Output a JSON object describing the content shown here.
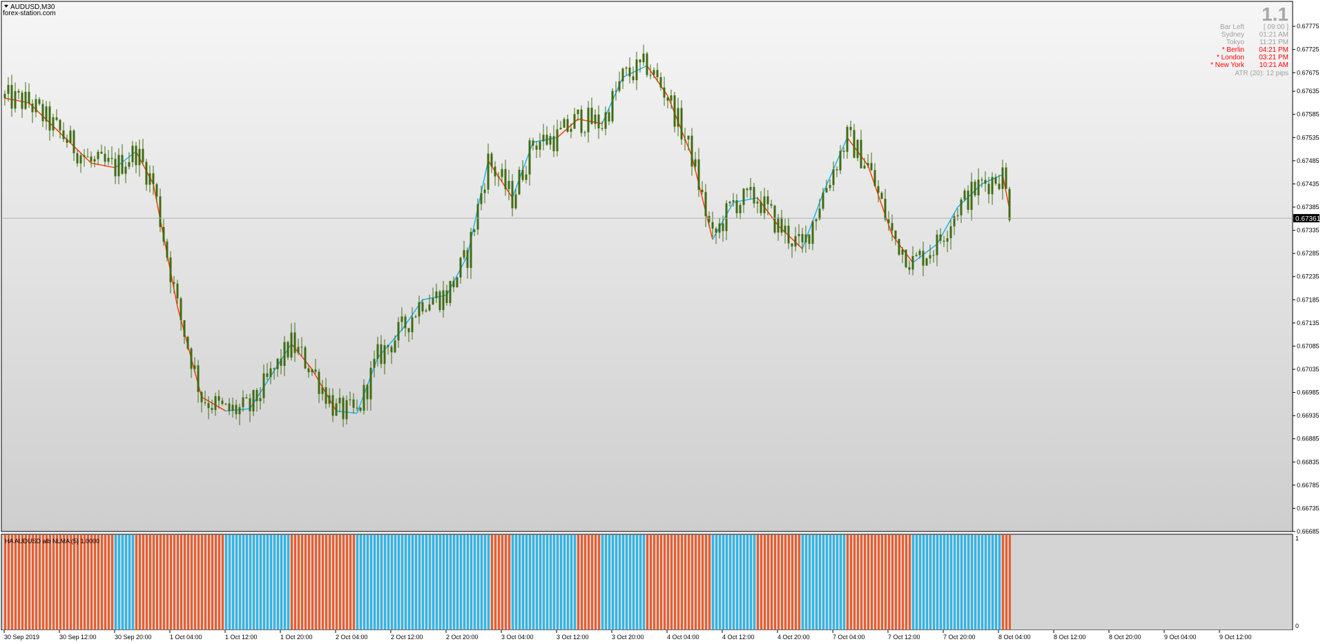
{
  "header": {
    "symbol_label": "AUDUSD,M30",
    "watermark": "forex-station.com"
  },
  "info_panel": {
    "big_value": "1.1",
    "rows": [
      {
        "label": "Bar Left",
        "value": "[ 09:00 ]",
        "color": "#a0a0a0"
      },
      {
        "label": "Sydney",
        "value": "01:21 AM",
        "color": "#a0a0a0"
      },
      {
        "label": "Tokyo",
        "value": "11:21 PM",
        "color": "#a0a0a0"
      },
      {
        "label": "* Berlin",
        "value": "04:21 PM",
        "color": "#ff0000"
      },
      {
        "label": "* London",
        "value": "03:21 PM",
        "color": "#ff0000"
      },
      {
        "label": "* New York",
        "value": "10:21 AM",
        "color": "#ff0000"
      }
    ],
    "atr_text": "ATR (20): 12 pips"
  },
  "colors": {
    "candle": "#3f6b12",
    "up_line": "#1ab2f0",
    "down_line": "#ff3c00",
    "hist_up": "#27b8ee",
    "hist_down": "#f05a28",
    "price_marker_bg": "#000000",
    "price_marker_fg": "#ffffff"
  },
  "chart_data": [
    {
      "type": "candlestick",
      "symbol": "AUDUSD",
      "timeframe": "M30",
      "ylim": [
        0.66685,
        0.67805
      ],
      "y_ticks": [
        "0.67775",
        "0.67725",
        "0.67675",
        "0.67635",
        "0.67585",
        "0.67535",
        "0.67485",
        "0.67435",
        "0.67385",
        "0.67335",
        "0.67285",
        "0.67235",
        "0.67185",
        "0.67135",
        "0.67085",
        "0.67035",
        "0.66985",
        "0.66935",
        "0.66885",
        "0.66835",
        "0.66785",
        "0.66735",
        "0.66685"
      ],
      "current_price": "0.67361",
      "x_ticks": [
        "30 Sep 2019",
        "30 Sep 12:00",
        "30 Sep 20:00",
        "1 Oct 04:00",
        "1 Oct 12:00",
        "1 Oct 20:00",
        "2 Oct 04:00",
        "2 Oct 12:00",
        "2 Oct 20:00",
        "3 Oct 04:00",
        "3 Oct 12:00",
        "3 Oct 20:00",
        "4 Oct 04:00",
        "4 Oct 12:00",
        "4 Oct 20:00",
        "7 Oct 04:00",
        "7 Oct 12:00",
        "7 Oct 20:00",
        "8 Oct 04:00",
        "8 Oct 12:00",
        "8 Oct 20:00",
        "9 Oct 04:00",
        "9 Oct 12:00"
      ],
      "trend_line": [
        {
          "bar": 0,
          "price": 0.6762,
          "dir": "down"
        },
        {
          "bar": 7,
          "price": 0.6761,
          "dir": "down"
        },
        {
          "bar": 25,
          "price": 0.6748,
          "dir": "down"
        },
        {
          "bar": 32,
          "price": 0.6747,
          "dir": "up"
        },
        {
          "bar": 38,
          "price": 0.67505,
          "dir": "down"
        },
        {
          "bar": 43,
          "price": 0.67435,
          "dir": "down"
        },
        {
          "bar": 50,
          "price": 0.6717,
          "dir": "down"
        },
        {
          "bar": 57,
          "price": 0.66975,
          "dir": "down"
        },
        {
          "bar": 64,
          "price": 0.66945,
          "dir": "up"
        },
        {
          "bar": 71,
          "price": 0.6695,
          "dir": "up"
        },
        {
          "bar": 83,
          "price": 0.6709,
          "dir": "down"
        },
        {
          "bar": 89,
          "price": 0.67035,
          "dir": "down"
        },
        {
          "bar": 96,
          "price": 0.66945,
          "dir": "up"
        },
        {
          "bar": 102,
          "price": 0.6694,
          "dir": "up"
        },
        {
          "bar": 108,
          "price": 0.6706,
          "dir": "up"
        },
        {
          "bar": 115,
          "price": 0.6712,
          "dir": "up"
        },
        {
          "bar": 121,
          "price": 0.67185,
          "dir": "up"
        },
        {
          "bar": 128,
          "price": 0.67195,
          "dir": "up"
        },
        {
          "bar": 134,
          "price": 0.6728,
          "dir": "up"
        },
        {
          "bar": 140,
          "price": 0.67485,
          "dir": "down"
        },
        {
          "bar": 147,
          "price": 0.67405,
          "dir": "up"
        },
        {
          "bar": 153,
          "price": 0.67525,
          "dir": "up"
        },
        {
          "bar": 160,
          "price": 0.67535,
          "dir": "down"
        },
        {
          "bar": 166,
          "price": 0.67575,
          "dir": "down"
        },
        {
          "bar": 173,
          "price": 0.67565,
          "dir": "up"
        },
        {
          "bar": 179,
          "price": 0.67665,
          "dir": "up"
        },
        {
          "bar": 186,
          "price": 0.6769,
          "dir": "down"
        },
        {
          "bar": 192,
          "price": 0.67625,
          "dir": "down"
        },
        {
          "bar": 199,
          "price": 0.67495,
          "dir": "down"
        },
        {
          "bar": 205,
          "price": 0.67315,
          "dir": "up"
        },
        {
          "bar": 211,
          "price": 0.67395,
          "dir": "up"
        },
        {
          "bar": 218,
          "price": 0.67405,
          "dir": "down"
        },
        {
          "bar": 224,
          "price": 0.67345,
          "dir": "down"
        },
        {
          "bar": 231,
          "price": 0.67295,
          "dir": "up"
        },
        {
          "bar": 237,
          "price": 0.67415,
          "dir": "up"
        },
        {
          "bar": 244,
          "price": 0.67535,
          "dir": "down"
        },
        {
          "bar": 250,
          "price": 0.67475,
          "dir": "down"
        },
        {
          "bar": 257,
          "price": 0.67325,
          "dir": "down"
        },
        {
          "bar": 263,
          "price": 0.67265,
          "dir": "up"
        },
        {
          "bar": 270,
          "price": 0.67305,
          "dir": "up"
        },
        {
          "bar": 276,
          "price": 0.67385,
          "dir": "up"
        },
        {
          "bar": 283,
          "price": 0.67435,
          "dir": "up"
        },
        {
          "bar": 289,
          "price": 0.67455,
          "dir": "down"
        },
        {
          "bar": 291,
          "price": 0.6738,
          "dir": "down"
        }
      ],
      "candle_count": 292
    },
    {
      "type": "histogram",
      "title": "HA AUDUSD alb NLMA (5) 1.0000",
      "ylim": [
        0,
        1
      ],
      "y_ticks": [
        "1",
        "0"
      ],
      "segments": [
        {
          "from": 0,
          "to": 32,
          "dir": "down"
        },
        {
          "from": 32,
          "to": 38,
          "dir": "up"
        },
        {
          "from": 38,
          "to": 64,
          "dir": "down"
        },
        {
          "from": 64,
          "to": 83,
          "dir": "up"
        },
        {
          "from": 83,
          "to": 102,
          "dir": "down"
        },
        {
          "from": 102,
          "to": 141,
          "dir": "up"
        },
        {
          "from": 141,
          "to": 147,
          "dir": "down"
        },
        {
          "from": 147,
          "to": 166,
          "dir": "up"
        },
        {
          "from": 166,
          "to": 173,
          "dir": "down"
        },
        {
          "from": 173,
          "to": 186,
          "dir": "up"
        },
        {
          "from": 186,
          "to": 205,
          "dir": "down"
        },
        {
          "from": 205,
          "to": 218,
          "dir": "up"
        },
        {
          "from": 218,
          "to": 231,
          "dir": "down"
        },
        {
          "from": 231,
          "to": 244,
          "dir": "up"
        },
        {
          "from": 244,
          "to": 263,
          "dir": "down"
        },
        {
          "from": 263,
          "to": 289,
          "dir": "up"
        },
        {
          "from": 289,
          "to": 292,
          "dir": "down"
        }
      ]
    }
  ]
}
